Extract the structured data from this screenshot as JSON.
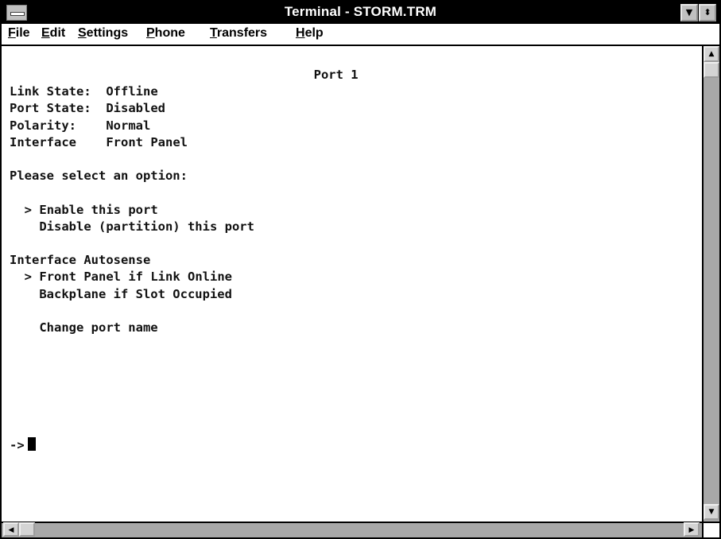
{
  "window": {
    "title": "Terminal - STORM.TRM"
  },
  "menubar": {
    "items": [
      {
        "first": "F",
        "rest": "ile"
      },
      {
        "first": "E",
        "rest": "dit"
      },
      {
        "first": "S",
        "rest": "ettings"
      },
      {
        "first": "P",
        "rest": "hone"
      },
      {
        "first": "T",
        "rest": "ransfers"
      },
      {
        "first": "H",
        "rest": "elp"
      }
    ]
  },
  "terminal": {
    "header": "Port 1",
    "status": [
      {
        "label": "Link State:",
        "value": "Offline"
      },
      {
        "label": "Port State:",
        "value": "Disabled"
      },
      {
        "label": "Polarity:",
        "value": "Normal"
      },
      {
        "label": "Interface",
        "value": "Front Panel"
      }
    ],
    "prompt_text": "Please select an option:",
    "port_options": [
      {
        "marker": ">",
        "text": "Enable this port"
      },
      {
        "marker": "",
        "text": "Disable (partition) this port"
      }
    ],
    "autosense_title": "Interface Autosense",
    "autosense_options": [
      {
        "marker": ">",
        "text": "Front Panel if Link Online"
      },
      {
        "marker": "",
        "text": "Backplane if Slot Occupied"
      }
    ],
    "change_name": "Change port name",
    "command_prompt": "->"
  },
  "icons": {
    "system_menu": "system-menu-icon",
    "minimize": "minimize-icon",
    "restore": "restore-icon",
    "scroll_up": "arrow-up-icon",
    "scroll_down": "arrow-down-icon",
    "scroll_left": "arrow-left-icon",
    "scroll_right": "arrow-right-icon",
    "cursor": "text-cursor-icon"
  },
  "colors": {
    "title_bar": "#000000",
    "scrollbar_track": "#a8a8a8",
    "button_face": "#d4d4d4"
  }
}
